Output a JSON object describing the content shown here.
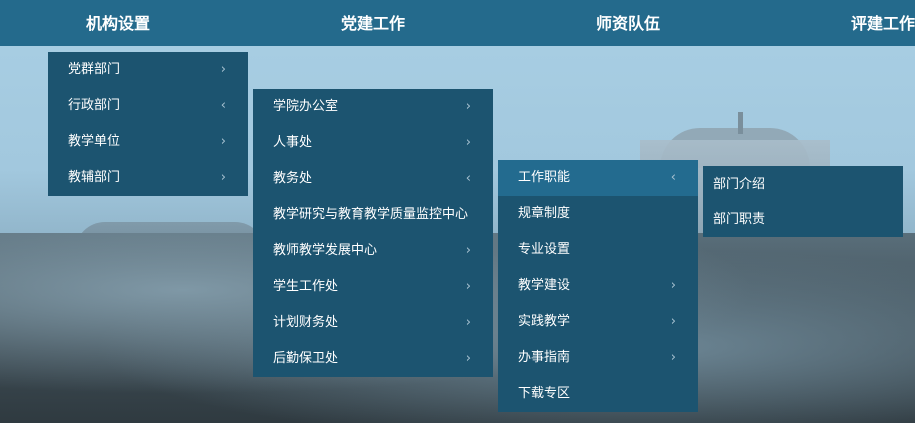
{
  "topnav": {
    "items": [
      "机构设置",
      "党建工作",
      "师资队伍",
      "评建工作"
    ]
  },
  "menu1": {
    "items": [
      {
        "label": "党群部门",
        "chevron": "›"
      },
      {
        "label": "行政部门",
        "chevron": "‹"
      },
      {
        "label": "教学单位",
        "chevron": "›"
      },
      {
        "label": "教辅部门",
        "chevron": "›"
      }
    ]
  },
  "menu2": {
    "items": [
      {
        "label": "学院办公室",
        "chevron": "›"
      },
      {
        "label": "人事处",
        "chevron": "›"
      },
      {
        "label": "教务处",
        "chevron": "‹"
      },
      {
        "label": "教学研究与教育教学质量监控中心",
        "chevron": ""
      },
      {
        "label": "教师教学发展中心",
        "chevron": "›"
      },
      {
        "label": "学生工作处",
        "chevron": "›"
      },
      {
        "label": "计划财务处",
        "chevron": "›"
      },
      {
        "label": "后勤保卫处",
        "chevron": "›"
      }
    ]
  },
  "menu3": {
    "items": [
      {
        "label": "工作职能",
        "chevron": "‹"
      },
      {
        "label": "规章制度",
        "chevron": ""
      },
      {
        "label": "专业设置",
        "chevron": ""
      },
      {
        "label": "教学建设",
        "chevron": "›"
      },
      {
        "label": "实践教学",
        "chevron": "›"
      },
      {
        "label": "办事指南",
        "chevron": "›"
      },
      {
        "label": "下载专区",
        "chevron": ""
      }
    ]
  },
  "menu4": {
    "items": [
      {
        "label": "部门介绍"
      },
      {
        "label": "部门职责"
      }
    ]
  },
  "colors": {
    "nav_bg": "#246a8c",
    "menu_bg": "#1c5470",
    "menu_active": "#236b8f"
  }
}
